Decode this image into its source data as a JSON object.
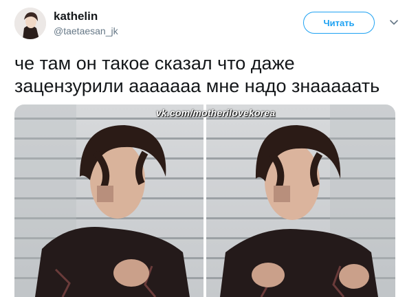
{
  "user": {
    "display_name": "kathelin",
    "handle": "@taetaesan_jk"
  },
  "follow_button": {
    "label": "Читать"
  },
  "icons": {
    "menu": "chevron-down-icon"
  },
  "tweet": {
    "lines": [
      "че там он такое сказал что даже",
      "зацензурили ааааааа мне надо знааааать"
    ]
  },
  "media": {
    "watermark": "vk.com/motherilovekorea",
    "photo_count": 2
  },
  "colors": {
    "accent": "#1da1f2",
    "text": "#14171a",
    "secondary": "#657786"
  }
}
